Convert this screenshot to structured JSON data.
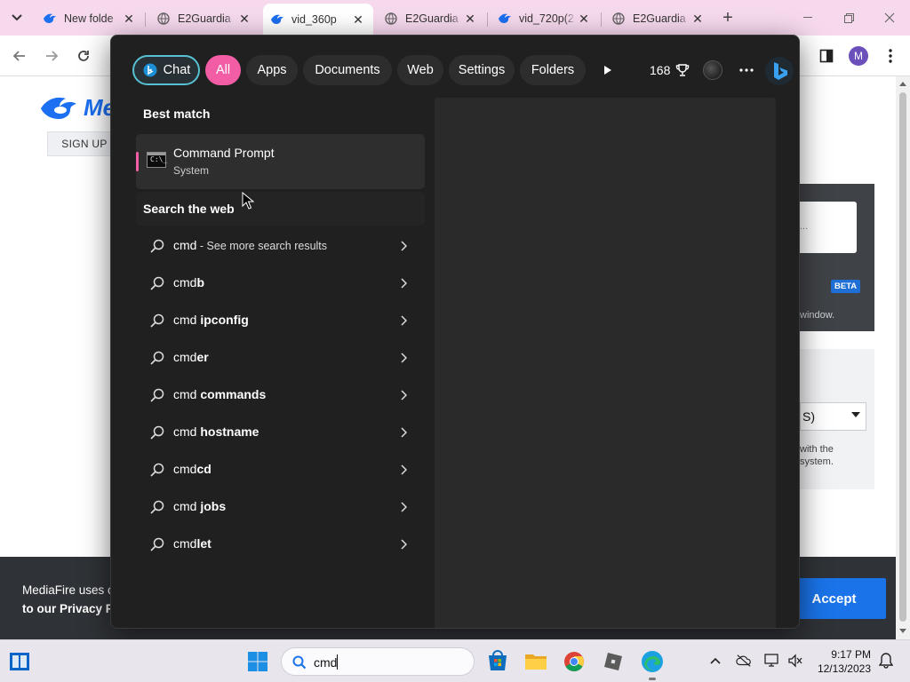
{
  "browser": {
    "tabs": [
      {
        "title": "New folde",
        "icon": "mediafire-icon"
      },
      {
        "title": "E2Guardia",
        "icon": "globe-icon"
      },
      {
        "title": "vid_360p",
        "icon": "mediafire-icon",
        "active": true
      },
      {
        "title": "E2Guardia",
        "icon": "globe-icon"
      },
      {
        "title": "vid_720p(2",
        "icon": "mediafire-icon"
      },
      {
        "title": "E2Guardia",
        "icon": "globe-icon"
      }
    ],
    "profile_initial": "M"
  },
  "page": {
    "logo_text": "Me",
    "signup_label": "SIGN UP",
    "panel_placeholder": "...",
    "beta_badge": "BETA",
    "panel_text": "window.",
    "select_value": "S)",
    "card_text_line1": "with the",
    "card_text_line2": "system.",
    "cookie_line1": "MediaFire uses c",
    "cookie_line2": "to our Privacy Po",
    "accept_label": "Accept"
  },
  "search_flyout": {
    "filters": {
      "chat": "Chat",
      "all": "All",
      "apps": "Apps",
      "documents": "Documents",
      "web": "Web",
      "settings": "Settings",
      "folders": "Folders"
    },
    "points": "168",
    "best_match_title": "Best match",
    "best_match": {
      "name": "Command Prompt",
      "subtitle": "System",
      "icon": "command-prompt-icon"
    },
    "web_section_title": "Search the web",
    "web_results": [
      {
        "prefix": "cmd",
        "bold": "",
        "suffix": " - See more search results"
      },
      {
        "prefix": "cmd",
        "bold": "b",
        "suffix": ""
      },
      {
        "prefix": "cmd ",
        "bold": "ipconfig",
        "suffix": ""
      },
      {
        "prefix": "cmd",
        "bold": "er",
        "suffix": ""
      },
      {
        "prefix": "cmd ",
        "bold": "commands",
        "suffix": ""
      },
      {
        "prefix": "cmd ",
        "bold": "hostname",
        "suffix": ""
      },
      {
        "prefix": "cmd",
        "bold": "cd",
        "suffix": ""
      },
      {
        "prefix": "cmd ",
        "bold": "jobs",
        "suffix": ""
      },
      {
        "prefix": "cmd",
        "bold": "let",
        "suffix": ""
      }
    ]
  },
  "taskbar": {
    "search_text": "cmd",
    "time": "9:17 PM",
    "date": "12/13/2023",
    "apps": [
      "start-icon",
      "microsoft-store-icon",
      "file-explorer-icon",
      "chrome-icon",
      "roblox-icon",
      "edge-icon"
    ]
  },
  "colors": {
    "accent_pink": "#f25da6",
    "chat_border": "#57c1d3",
    "flyout_bg": "#202020",
    "tab_strip": "#f6d9ed"
  }
}
